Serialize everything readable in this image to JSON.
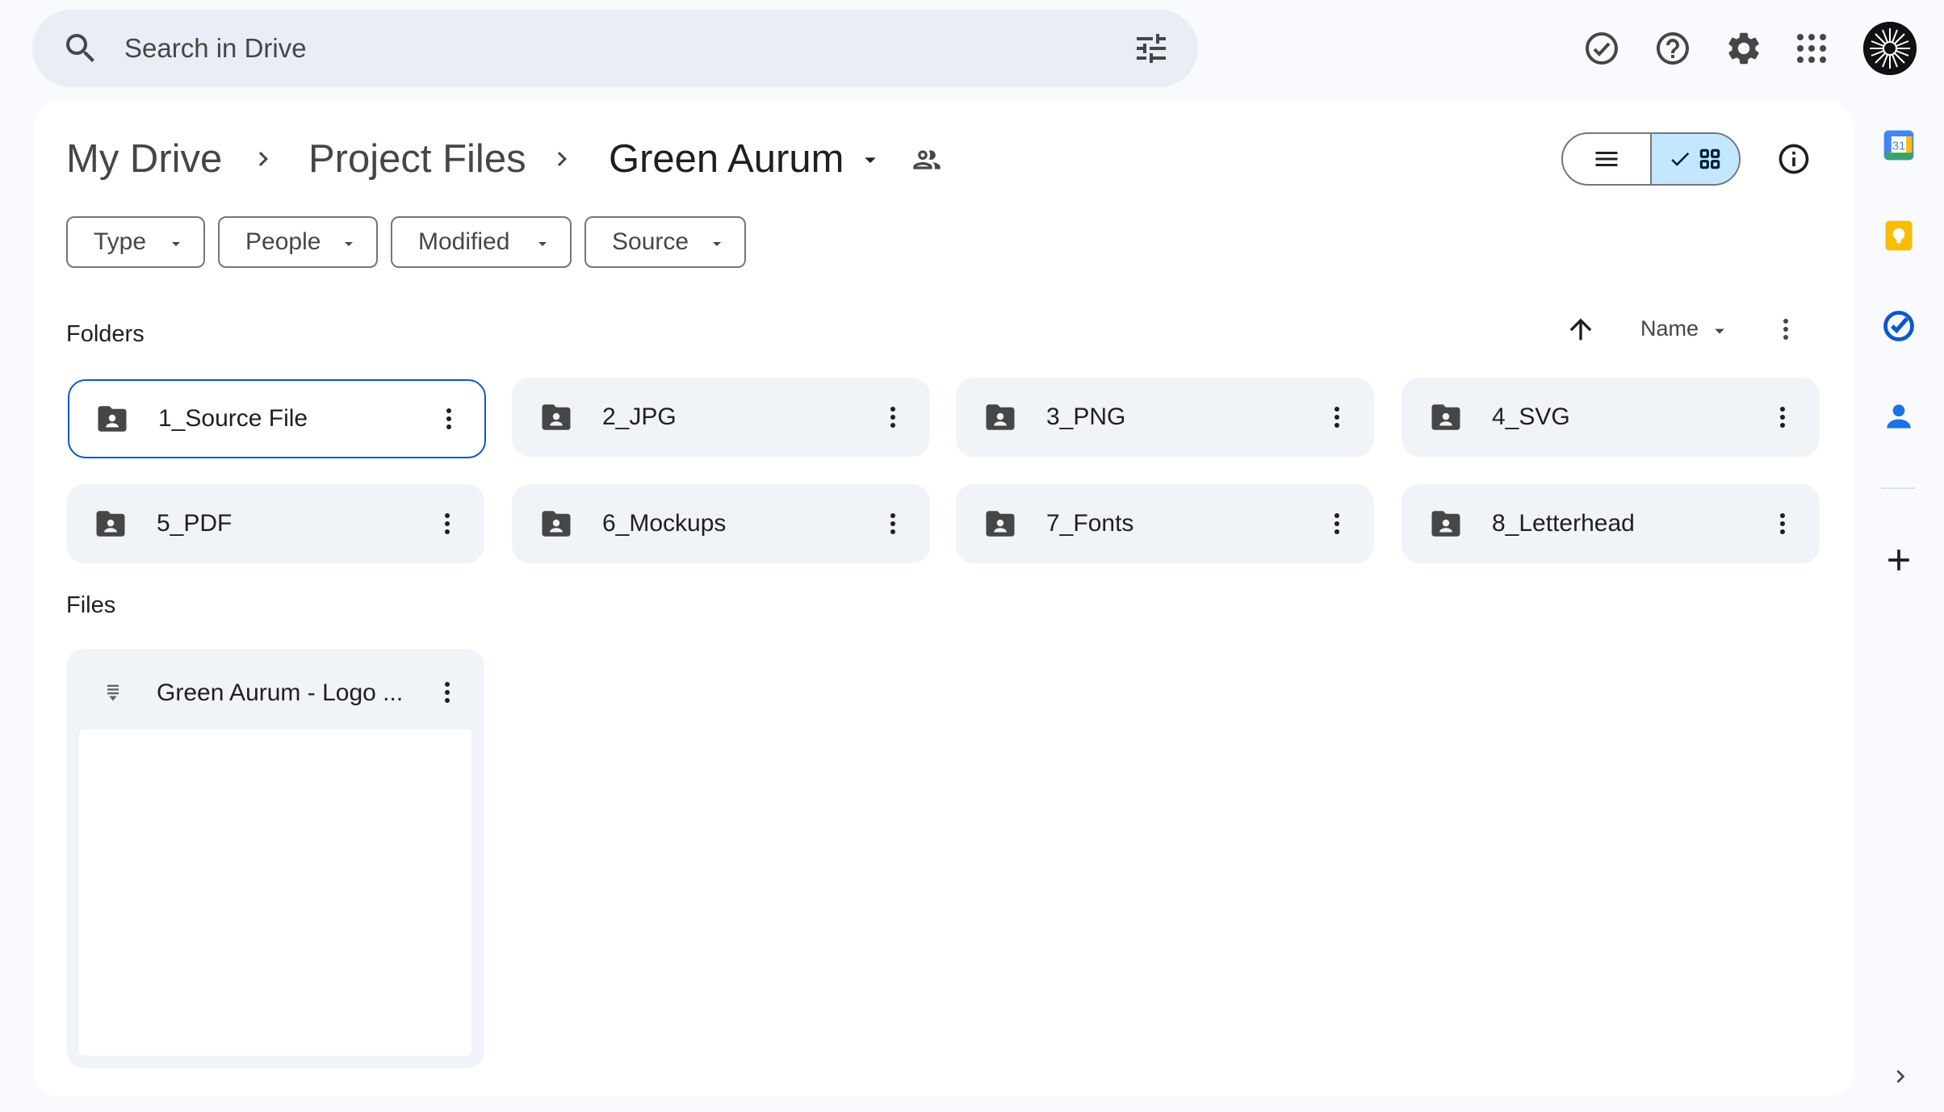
{
  "search": {
    "placeholder": "Search in Drive"
  },
  "breadcrumb": {
    "items": [
      "My Drive",
      "Project Files",
      "Green Aurum"
    ]
  },
  "filters": [
    {
      "label": "Type"
    },
    {
      "label": "People"
    },
    {
      "label": "Modified"
    },
    {
      "label": "Source"
    }
  ],
  "sections": {
    "folders_label": "Folders",
    "files_label": "Files"
  },
  "sort": {
    "label": "Name",
    "direction": "ascending"
  },
  "folders": [
    {
      "name": "1_Source File",
      "selected": true
    },
    {
      "name": "2_JPG"
    },
    {
      "name": "3_PNG"
    },
    {
      "name": "4_SVG"
    },
    {
      "name": "5_PDF"
    },
    {
      "name": "6_Mockups"
    },
    {
      "name": "7_Fonts"
    },
    {
      "name": "8_Letterhead"
    }
  ],
  "files": [
    {
      "name": "Green Aurum - Logo ..."
    }
  ],
  "view": {
    "active": "grid"
  },
  "side_panel": {
    "calendar_day": "31"
  },
  "colors": {
    "accent": "#0b57d0",
    "toggle_active": "#c2e7ff",
    "surface": "#f0f4f9",
    "background": "#f8fafd",
    "calendar_blue": "#4285f4",
    "keep_yellow": "#fbbc04",
    "tasks_blue": "#0b57d0",
    "contacts_blue": "#1a73e8"
  }
}
